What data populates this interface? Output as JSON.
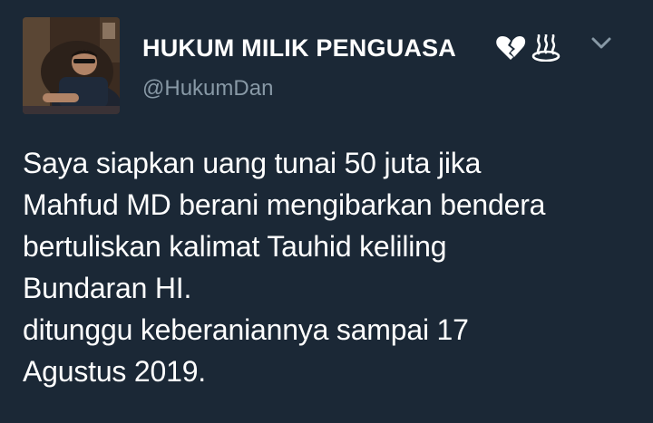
{
  "author": {
    "display_name": "HUKUM MILIK PENGUASA",
    "name_emojis": [
      "broken-heart-icon",
      "hot-springs-icon"
    ],
    "handle": "@HukumDan",
    "avatar": "profile-photo"
  },
  "tweet": {
    "lines": [
      "Saya siapkan uang tunai 50 juta jika",
      "Mahfud MD berani mengibarkan bendera",
      "bertuliskan kalimat Tauhid keliling",
      "Bundaran HI.",
      "ditunggu keberaniannya sampai 17",
      "Agustus 2019."
    ]
  },
  "menu": {
    "icon": "chevron-down-icon"
  },
  "colors": {
    "background": "#1b2836",
    "text": "#ffffff",
    "handle": "#8899a6",
    "heart": "#ffffff"
  }
}
